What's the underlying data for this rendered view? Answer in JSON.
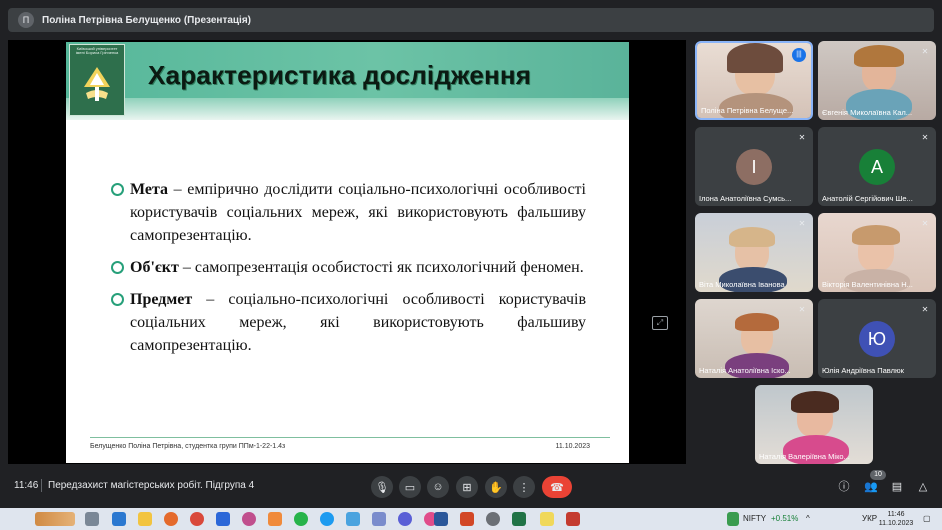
{
  "window": {
    "avatar_letter": "П",
    "title": "Поліна Петрівна Белущенко (Презентація)"
  },
  "slide": {
    "logo_text": "Київський університет імені Бориса Грінченка",
    "title": "Характеристика дослідження",
    "bullets": [
      {
        "term": "Мета",
        "text": " – емпірично дослідити соціально-психологічні особливості користувачів соціальних мереж, які використовують фальшиву самопрезентацію."
      },
      {
        "term": "Об'єкт",
        "text": " – самопрезентація особистості як психологічний феномен."
      },
      {
        "term": "Предмет",
        "text": " – соціально-психологічні особливості користувачів соціальних мереж, які використовують фальшиву самопрезентацію."
      }
    ],
    "footer_author": "Белущенко Поліна Петрівна, студентка групи ППм-1-22-1.4з",
    "footer_date": "11.10.2023"
  },
  "participants": [
    {
      "name": "Поліна Петрівна Белуще...",
      "type": "video"
    },
    {
      "name": "Євгенія Миколаївна Кал...",
      "type": "video"
    },
    {
      "name": "Ілона Анатоліївна Сумсь...",
      "type": "letter",
      "letter": "І",
      "color": "#8d6e63"
    },
    {
      "name": "Анатолій Сергійович Ше...",
      "type": "letter",
      "letter": "А",
      "color": "#188038"
    },
    {
      "name": "Віта Миколаївна Іванова",
      "type": "video"
    },
    {
      "name": "Вікторія Валентинівна Н...",
      "type": "video"
    },
    {
      "name": "Наталія Анатоліївна Іско...",
      "type": "video"
    },
    {
      "name": "Юлія Андріївна Павлюк",
      "type": "letter",
      "letter": "Ю",
      "color": "#3f51b5"
    },
    {
      "name": "Наталія Валеріївна Міко...",
      "type": "video"
    }
  ],
  "bottombar": {
    "time": "11:46",
    "meeting_name": "Передзахист магістерських робіт. Підгрупа 4",
    "people_count": "10"
  },
  "taskbar": {
    "ticker": "NIFTY",
    "ticker_change": "+0.51%",
    "language": "УКР",
    "clock_time": "11:46",
    "clock_date": "11.10.2023"
  },
  "colors": {
    "end_call": "#ea4335",
    "accent": "#8ab4f8",
    "slide_green": "#56b79a"
  }
}
